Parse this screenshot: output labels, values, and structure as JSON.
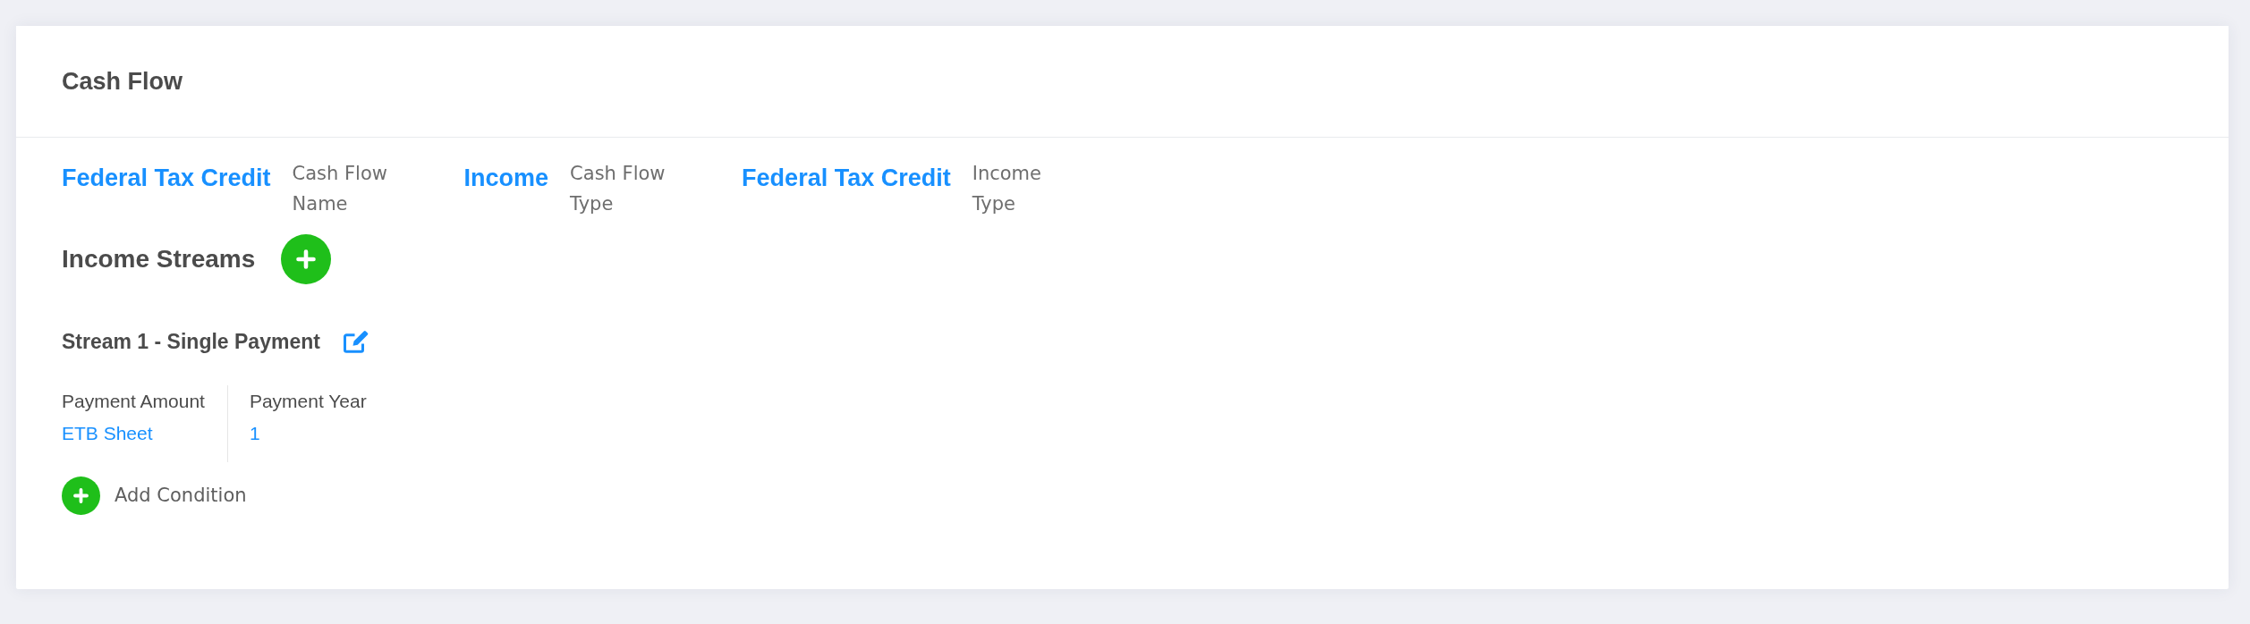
{
  "card": {
    "title": "Cash Flow"
  },
  "summary_fields": [
    {
      "value": "Federal Tax Credit",
      "label": "Cash Flow Name"
    },
    {
      "value": "Income",
      "label": "Cash Flow Type"
    },
    {
      "value": "Federal Tax Credit",
      "label": "Income Type"
    }
  ],
  "income_streams": {
    "title": "Income Streams",
    "streams": [
      {
        "title": "Stream 1 - Single Payment",
        "fields": [
          {
            "label": "Payment Amount",
            "value": "ETB Sheet"
          },
          {
            "label": "Payment Year",
            "value": "1"
          }
        ],
        "add_condition": "Add Condition"
      }
    ]
  }
}
